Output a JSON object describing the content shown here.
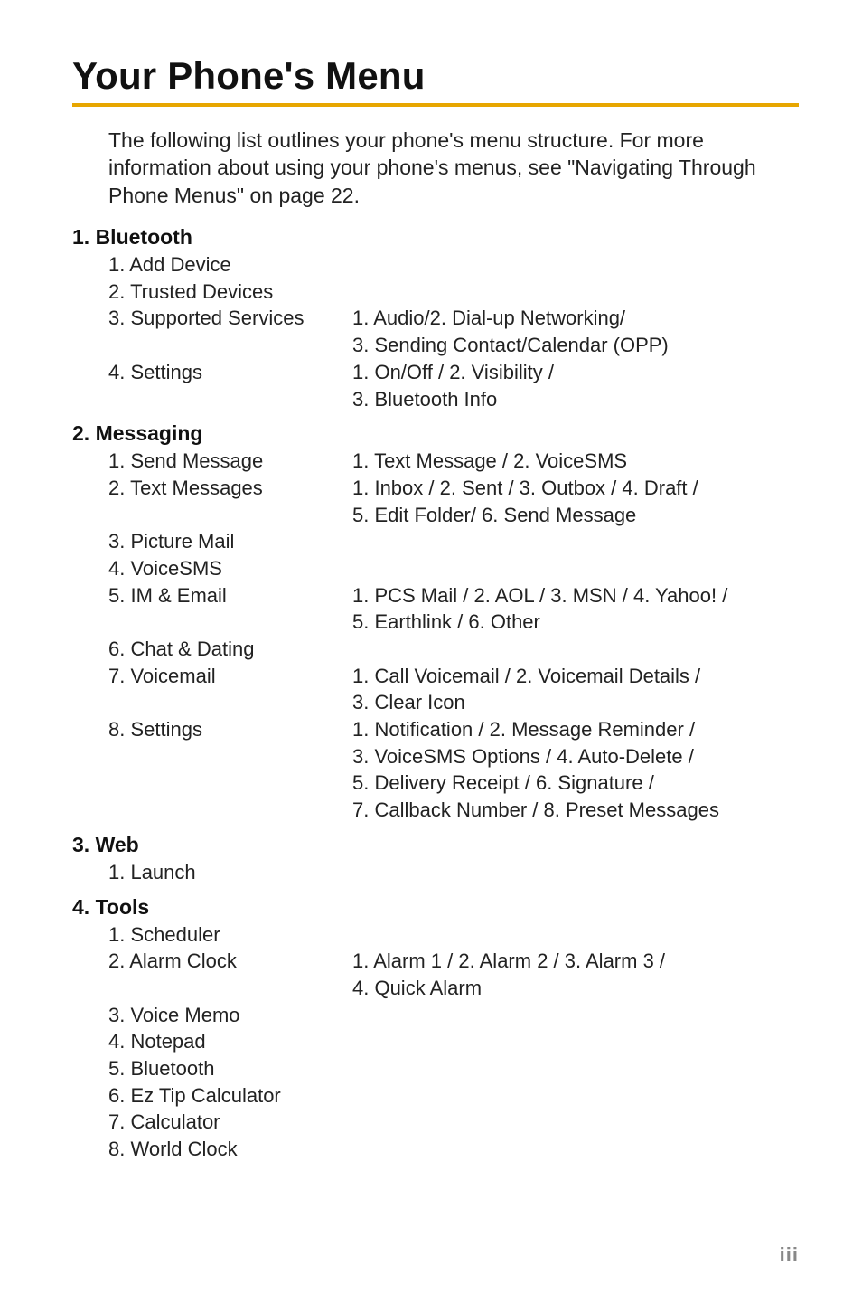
{
  "page": {
    "title": "Your Phone's Menu",
    "intro": "The following list outlines your phone's menu structure. For more information about using your phone's menus, see \"Navigating Through Phone Menus\" on page 22.",
    "pagenum": "iii"
  },
  "sections": [
    {
      "head": "1. Bluetooth",
      "rows": [
        {
          "left": "1.  Add Device",
          "right": ""
        },
        {
          "left": "2.  Trusted Devices",
          "right": ""
        },
        {
          "left": "3.  Supported Services",
          "right": "1. Audio/2. Dial-up Networking/"
        },
        {
          "left": "",
          "right": "3. Sending Contact/Calendar (OPP)"
        },
        {
          "left": "4.  Settings",
          "right": "1. On/Off / 2. Visibility /"
        },
        {
          "left": "",
          "right": "3. Bluetooth Info"
        }
      ]
    },
    {
      "head": "2. Messaging",
      "rows": [
        {
          "left": "1.  Send Message",
          "right": "1. Text Message / 2. VoiceSMS"
        },
        {
          "left": "2.  Text Messages",
          "right": "1. Inbox / 2. Sent / 3. Outbox / 4. Draft /"
        },
        {
          "left": "",
          "right": "5. Edit Folder/ 6. Send Message"
        },
        {
          "left": "3.  Picture Mail",
          "right": ""
        },
        {
          "left": "4.  VoiceSMS",
          "right": ""
        },
        {
          "left": "5.  IM & Email",
          "right": "1. PCS Mail / 2. AOL / 3. MSN / 4. Yahoo! /"
        },
        {
          "left": "",
          "right": "5. Earthlink / 6. Other"
        },
        {
          "left": "6.  Chat & Dating",
          "right": ""
        },
        {
          "left": "7.  Voicemail",
          "right": "1. Call Voicemail / 2. Voicemail Details /"
        },
        {
          "left": "",
          "right": "3. Clear Icon"
        },
        {
          "left": "8.  Settings",
          "right": "1. Notification / 2. Message Reminder /"
        },
        {
          "left": "",
          "right": "3. VoiceSMS Options / 4. Auto-Delete /"
        },
        {
          "left": "",
          "right": "5. Delivery Receipt / 6. Signature /"
        },
        {
          "left": "",
          "right": "7. Callback Number / 8. Preset Messages"
        }
      ]
    },
    {
      "head": "3. Web",
      "rows": [
        {
          "left": "1.  Launch",
          "right": ""
        }
      ]
    },
    {
      "head": "4. Tools",
      "rows": [
        {
          "left": "1.  Scheduler",
          "right": ""
        },
        {
          "left": "2.  Alarm Clock",
          "right": "1. Alarm 1 / 2. Alarm 2 / 3. Alarm 3 /"
        },
        {
          "left": "",
          "right": "4. Quick Alarm"
        },
        {
          "left": "3.  Voice Memo",
          "right": ""
        },
        {
          "left": "4.  Notepad",
          "right": ""
        },
        {
          "left": "5.  Bluetooth",
          "right": ""
        },
        {
          "left": "6.  Ez Tip Calculator",
          "right": ""
        },
        {
          "left": "7.  Calculator",
          "right": ""
        },
        {
          "left": "8.  World Clock",
          "right": ""
        }
      ]
    }
  ]
}
